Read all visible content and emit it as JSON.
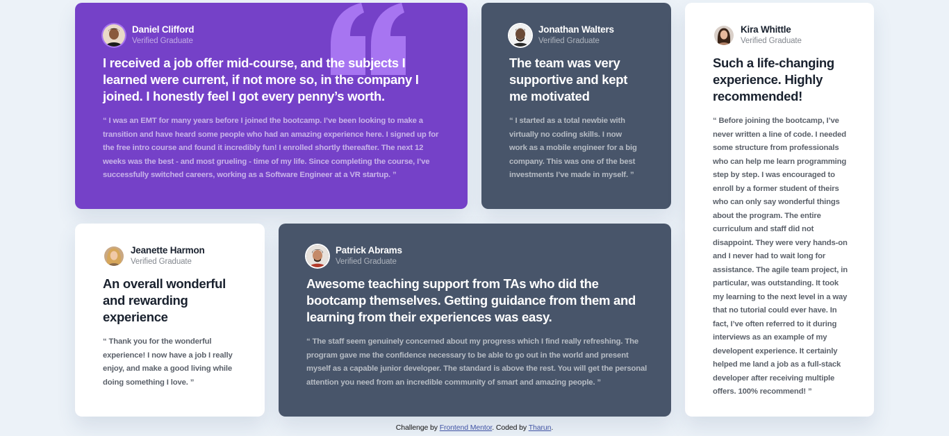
{
  "colors": {
    "page_background": "#ecf2f8",
    "moderate_violet": "#7541c8",
    "very_dark_grayish_blue": "#48556a",
    "white": "#ffffff",
    "quote_mark": "#a775f1",
    "footer_link": "#3e52a3"
  },
  "testimonials": [
    {
      "name": "Daniel Clifford",
      "role": "Verified Graduate",
      "headline": "I received a job offer mid-course, and the subjects I learned were current, if not more so, in the company I joined. I honestly feel I got every penny’s worth.",
      "body": "“ I was an EMT for many years before I joined the bootcamp. I’ve been looking to make a transition and have heard some people who had an amazing experience here. I signed up for the free intro course and found it incredibly fun! I enrolled shortly thereafter. The next 12 weeks was the best - and most grueling - time of my life. Since completing the course, I’ve successfully switched careers, working as a Software Engineer at a VR startup. ”",
      "avatar_icon": "avatar-daniel-icon",
      "theme": "purple"
    },
    {
      "name": "Jonathan Walters",
      "role": "Verified Graduate",
      "headline": "The team was very supportive and kept me motivated",
      "body": "“ I started as a total newbie with virtually no coding skills. I now work as a mobile engineer for a big company. This was one of the best investments I’ve made in myself. ”",
      "avatar_icon": "avatar-jonathan-icon",
      "theme": "slate"
    },
    {
      "name": "Kira Whittle",
      "role": "Verified Graduate",
      "headline": "Such a life-changing experience. Highly recommended!",
      "body": "“ Before joining the bootcamp, I’ve never written a line of code. I needed some structure from professionals who can help me learn programming step by step. I was encouraged to enroll by a former student of theirs who can only say wonderful things about the program. The entire curriculum and staff did not disappoint. They were very hands-on and I never had to wait long for assistance. The agile team project, in particular, was outstanding. It took my learning to the next level in a way that no tutorial could ever have. In fact, I’ve often referred to it during interviews as an example of my developent experience. It certainly helped me land a job as a full-stack developer after receiving multiple offers. 100% recommend! ”",
      "avatar_icon": "avatar-kira-icon",
      "theme": "white"
    },
    {
      "name": "Jeanette Harmon",
      "role": "Verified Graduate",
      "headline": "An overall wonderful and rewarding experience",
      "body": "“ Thank you for the wonderful experience! I now have a job I really enjoy, and make a good living while doing something I love. ”",
      "avatar_icon": "avatar-jeanette-icon",
      "theme": "white"
    },
    {
      "name": "Patrick Abrams",
      "role": "Verified Graduate",
      "headline": "Awesome teaching support from TAs who did the bootcamp themselves. Getting guidance from them and learning from their experiences was easy.",
      "body": "“ The staff seem genuinely concerned about my progress which I find really refreshing. The program gave me the confidence necessary to be able to go out in the world and present myself as a capable junior developer. The standard is above the rest. You will get the personal attention you need from an incredible community of smart and amazing people. ”",
      "avatar_icon": "avatar-patrick-icon",
      "theme": "slate"
    }
  ],
  "decor": {
    "quote_icon": "quote-mark-icon"
  },
  "footer": {
    "prefix": "Challenge by ",
    "link1": "Frontend Mentor",
    "middle": ". Coded by ",
    "link2": "Tharun",
    "suffix": "."
  }
}
